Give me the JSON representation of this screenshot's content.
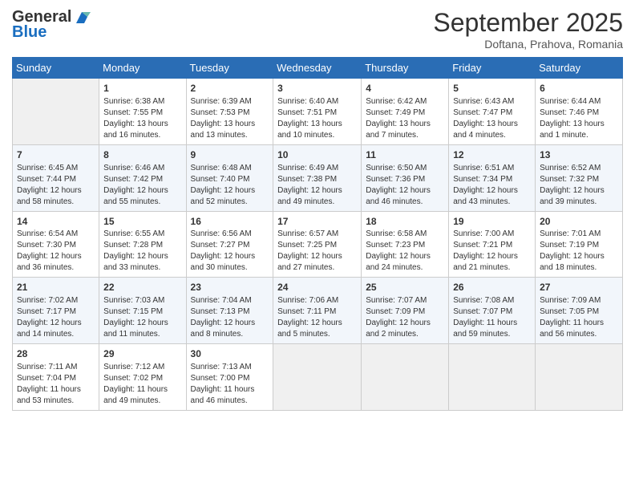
{
  "header": {
    "logo_line1": "General",
    "logo_line2": "Blue",
    "month": "September 2025",
    "location": "Doftana, Prahova, Romania"
  },
  "days_of_week": [
    "Sunday",
    "Monday",
    "Tuesday",
    "Wednesday",
    "Thursday",
    "Friday",
    "Saturday"
  ],
  "weeks": [
    [
      {
        "day": "",
        "info": ""
      },
      {
        "day": "1",
        "info": "Sunrise: 6:38 AM\nSunset: 7:55 PM\nDaylight: 13 hours\nand 16 minutes."
      },
      {
        "day": "2",
        "info": "Sunrise: 6:39 AM\nSunset: 7:53 PM\nDaylight: 13 hours\nand 13 minutes."
      },
      {
        "day": "3",
        "info": "Sunrise: 6:40 AM\nSunset: 7:51 PM\nDaylight: 13 hours\nand 10 minutes."
      },
      {
        "day": "4",
        "info": "Sunrise: 6:42 AM\nSunset: 7:49 PM\nDaylight: 13 hours\nand 7 minutes."
      },
      {
        "day": "5",
        "info": "Sunrise: 6:43 AM\nSunset: 7:47 PM\nDaylight: 13 hours\nand 4 minutes."
      },
      {
        "day": "6",
        "info": "Sunrise: 6:44 AM\nSunset: 7:46 PM\nDaylight: 13 hours\nand 1 minute."
      }
    ],
    [
      {
        "day": "7",
        "info": "Sunrise: 6:45 AM\nSunset: 7:44 PM\nDaylight: 12 hours\nand 58 minutes."
      },
      {
        "day": "8",
        "info": "Sunrise: 6:46 AM\nSunset: 7:42 PM\nDaylight: 12 hours\nand 55 minutes."
      },
      {
        "day": "9",
        "info": "Sunrise: 6:48 AM\nSunset: 7:40 PM\nDaylight: 12 hours\nand 52 minutes."
      },
      {
        "day": "10",
        "info": "Sunrise: 6:49 AM\nSunset: 7:38 PM\nDaylight: 12 hours\nand 49 minutes."
      },
      {
        "day": "11",
        "info": "Sunrise: 6:50 AM\nSunset: 7:36 PM\nDaylight: 12 hours\nand 46 minutes."
      },
      {
        "day": "12",
        "info": "Sunrise: 6:51 AM\nSunset: 7:34 PM\nDaylight: 12 hours\nand 43 minutes."
      },
      {
        "day": "13",
        "info": "Sunrise: 6:52 AM\nSunset: 7:32 PM\nDaylight: 12 hours\nand 39 minutes."
      }
    ],
    [
      {
        "day": "14",
        "info": "Sunrise: 6:54 AM\nSunset: 7:30 PM\nDaylight: 12 hours\nand 36 minutes."
      },
      {
        "day": "15",
        "info": "Sunrise: 6:55 AM\nSunset: 7:28 PM\nDaylight: 12 hours\nand 33 minutes."
      },
      {
        "day": "16",
        "info": "Sunrise: 6:56 AM\nSunset: 7:27 PM\nDaylight: 12 hours\nand 30 minutes."
      },
      {
        "day": "17",
        "info": "Sunrise: 6:57 AM\nSunset: 7:25 PM\nDaylight: 12 hours\nand 27 minutes."
      },
      {
        "day": "18",
        "info": "Sunrise: 6:58 AM\nSunset: 7:23 PM\nDaylight: 12 hours\nand 24 minutes."
      },
      {
        "day": "19",
        "info": "Sunrise: 7:00 AM\nSunset: 7:21 PM\nDaylight: 12 hours\nand 21 minutes."
      },
      {
        "day": "20",
        "info": "Sunrise: 7:01 AM\nSunset: 7:19 PM\nDaylight: 12 hours\nand 18 minutes."
      }
    ],
    [
      {
        "day": "21",
        "info": "Sunrise: 7:02 AM\nSunset: 7:17 PM\nDaylight: 12 hours\nand 14 minutes."
      },
      {
        "day": "22",
        "info": "Sunrise: 7:03 AM\nSunset: 7:15 PM\nDaylight: 12 hours\nand 11 minutes."
      },
      {
        "day": "23",
        "info": "Sunrise: 7:04 AM\nSunset: 7:13 PM\nDaylight: 12 hours\nand 8 minutes."
      },
      {
        "day": "24",
        "info": "Sunrise: 7:06 AM\nSunset: 7:11 PM\nDaylight: 12 hours\nand 5 minutes."
      },
      {
        "day": "25",
        "info": "Sunrise: 7:07 AM\nSunset: 7:09 PM\nDaylight: 12 hours\nand 2 minutes."
      },
      {
        "day": "26",
        "info": "Sunrise: 7:08 AM\nSunset: 7:07 PM\nDaylight: 11 hours\nand 59 minutes."
      },
      {
        "day": "27",
        "info": "Sunrise: 7:09 AM\nSunset: 7:05 PM\nDaylight: 11 hours\nand 56 minutes."
      }
    ],
    [
      {
        "day": "28",
        "info": "Sunrise: 7:11 AM\nSunset: 7:04 PM\nDaylight: 11 hours\nand 53 minutes."
      },
      {
        "day": "29",
        "info": "Sunrise: 7:12 AM\nSunset: 7:02 PM\nDaylight: 11 hours\nand 49 minutes."
      },
      {
        "day": "30",
        "info": "Sunrise: 7:13 AM\nSunset: 7:00 PM\nDaylight: 11 hours\nand 46 minutes."
      },
      {
        "day": "",
        "info": ""
      },
      {
        "day": "",
        "info": ""
      },
      {
        "day": "",
        "info": ""
      },
      {
        "day": "",
        "info": ""
      }
    ]
  ]
}
